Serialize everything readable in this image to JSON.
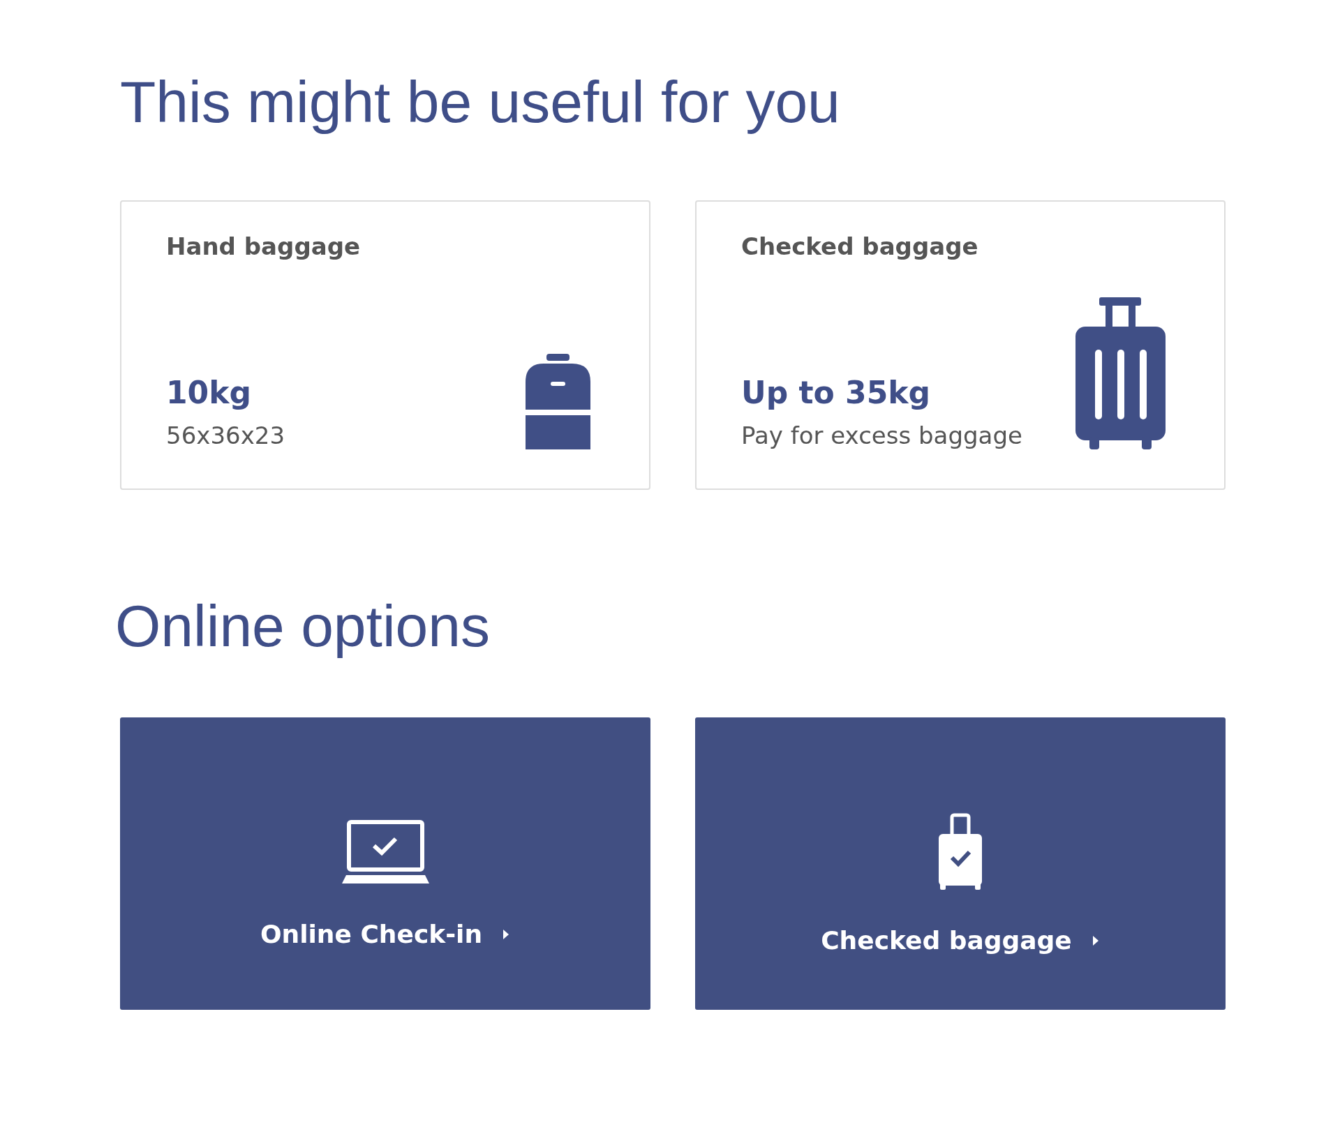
{
  "useful_section": {
    "heading": "This might be useful for you",
    "cards": [
      {
        "kind": "backpack",
        "title": "Hand baggage",
        "value": "10kg",
        "detail": "56x36x23"
      },
      {
        "kind": "suitcase",
        "title": "Checked baggage",
        "value": "Up to 35kg",
        "detail": "Pay for excess baggage"
      }
    ]
  },
  "online_section": {
    "heading": "Online options",
    "buttons": [
      {
        "kind": "laptop",
        "label": "Online Check-in"
      },
      {
        "kind": "luggage",
        "label": "Checked baggage"
      }
    ]
  }
}
